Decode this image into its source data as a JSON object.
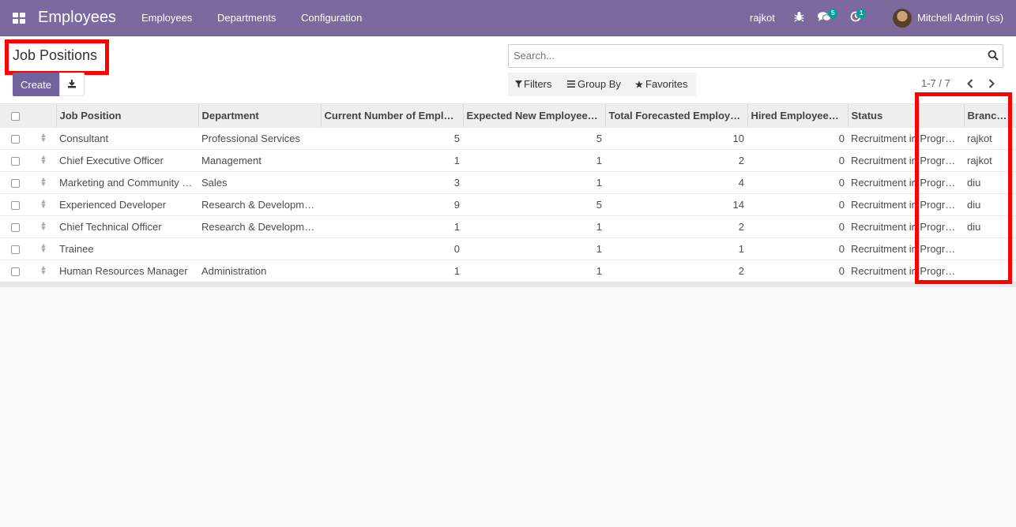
{
  "navbar": {
    "brand": "Employees",
    "menu": [
      "Employees",
      "Departments",
      "Configuration"
    ],
    "company": "rajkot",
    "messages_count": "5",
    "activities_count": "1",
    "user": "Mitchell Admin (ss)"
  },
  "control_panel": {
    "title": "Job Positions",
    "create_label": "Create",
    "search_placeholder": "Search...",
    "filters_label": "Filters",
    "group_by_label": "Group By",
    "favorites_label": "Favorites",
    "pager": "1-7 / 7"
  },
  "table": {
    "columns": [
      "Job Position",
      "Department",
      "Current Number of Employees",
      "Expected New Employees",
      "Total Forecasted Employees",
      "Hired Employees",
      "Status",
      "Branch"
    ],
    "column_display": [
      "Job Position",
      "Department",
      "Current Number of Empl…",
      "Expected New Employee…",
      "Total Forecasted Employ…",
      "Hired Employees…",
      "Status",
      "Branch…"
    ],
    "rows": [
      {
        "job": "Consultant",
        "department": "Professional Services",
        "current": "5",
        "expected": "5",
        "total": "10",
        "hired": "0",
        "status": "Recruitment in Progress",
        "branch": "rajkot"
      },
      {
        "job": "Chief Executive Officer",
        "department": "Management",
        "current": "1",
        "expected": "1",
        "total": "2",
        "hired": "0",
        "status": "Recruitment in Progress",
        "branch": "rajkot"
      },
      {
        "job": "Marketing and Community Manager",
        "department": "Sales",
        "current": "3",
        "expected": "1",
        "total": "4",
        "hired": "0",
        "status": "Recruitment in Progress",
        "branch": "diu"
      },
      {
        "job": "Experienced Developer",
        "department": "Research & Development",
        "current": "9",
        "expected": "5",
        "total": "14",
        "hired": "0",
        "status": "Recruitment in Progress",
        "branch": "diu"
      },
      {
        "job": "Chief Technical Officer",
        "department": "Research & Development",
        "current": "1",
        "expected": "1",
        "total": "2",
        "hired": "0",
        "status": "Recruitment in Progress",
        "branch": "diu"
      },
      {
        "job": "Trainee",
        "department": "",
        "current": "0",
        "expected": "1",
        "total": "1",
        "hired": "0",
        "status": "Recruitment in Progress",
        "branch": ""
      },
      {
        "job": "Human Resources Manager",
        "department": "Administration",
        "current": "1",
        "expected": "1",
        "total": "2",
        "hired": "0",
        "status": "Recruitment in Progress",
        "branch": ""
      }
    ]
  },
  "colors": {
    "navbar": "#7c6a9e",
    "primary_button": "#71639e",
    "highlight": "#ff0000",
    "badge": "#00a09d"
  }
}
